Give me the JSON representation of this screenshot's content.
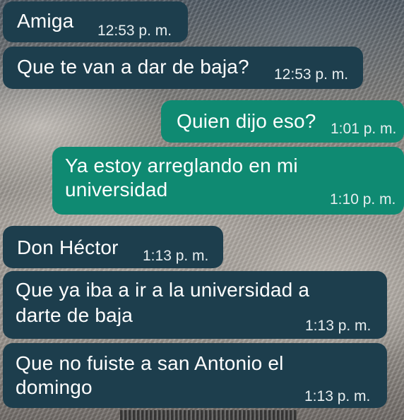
{
  "chat": {
    "messages": [
      {
        "direction": "incoming",
        "lines": [
          "Amiga"
        ],
        "time": "12:53 p. m."
      },
      {
        "direction": "incoming",
        "lines": [
          "Que te van a dar de baja?"
        ],
        "time": "12:53 p. m."
      },
      {
        "direction": "outgoing",
        "lines": [
          "Quien dijo eso?"
        ],
        "time": "1:01 p. m."
      },
      {
        "direction": "outgoing",
        "lines": [
          "Ya estoy arreglando en mi",
          "universidad"
        ],
        "time": "1:10 p. m."
      },
      {
        "direction": "incoming",
        "lines": [
          "Don Héctor"
        ],
        "time": "1:13 p. m."
      },
      {
        "direction": "incoming",
        "lines": [
          "Que ya iba a ir a la universidad a",
          "darte de baja"
        ],
        "time": "1:13 p. m."
      },
      {
        "direction": "incoming",
        "lines": [
          "Que no fuiste a san Antonio el",
          "domingo"
        ],
        "time": "1:13 p. m."
      }
    ]
  },
  "colors": {
    "incoming_bubble": "#1d3e4d",
    "outgoing_bubble": "#0f8a72",
    "text": "#ffffff"
  }
}
